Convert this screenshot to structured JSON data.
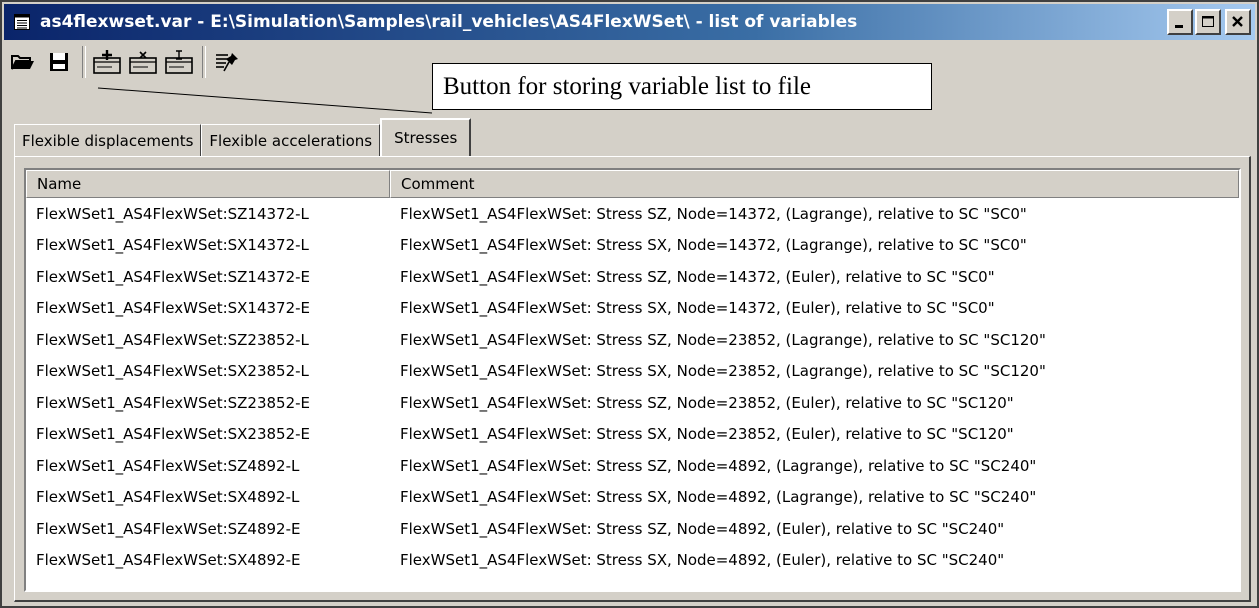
{
  "window": {
    "title": "as4flexwset.var - E:\\Simulation\\Samples\\rail_vehicles\\AS4FlexWSet\\ - list of variables"
  },
  "callout": {
    "text": "Button for storing variable list to file"
  },
  "tabs": [
    {
      "label": "Flexible displacements",
      "active": false
    },
    {
      "label": "Flexible accelerations",
      "active": false
    },
    {
      "label": "Stresses",
      "active": true
    }
  ],
  "list": {
    "columns": [
      "Name",
      "Comment"
    ],
    "rows": [
      {
        "name": "FlexWSet1_AS4FlexWSet:SZ14372-L",
        "comment": "FlexWSet1_AS4FlexWSet: Stress SZ, Node=14372, (Lagrange), relative to SC \"SC0\""
      },
      {
        "name": "FlexWSet1_AS4FlexWSet:SX14372-L",
        "comment": "FlexWSet1_AS4FlexWSet: Stress SX, Node=14372, (Lagrange), relative to SC \"SC0\""
      },
      {
        "name": "FlexWSet1_AS4FlexWSet:SZ14372-E",
        "comment": "FlexWSet1_AS4FlexWSet: Stress SZ, Node=14372, (Euler), relative to SC \"SC0\""
      },
      {
        "name": "FlexWSet1_AS4FlexWSet:SX14372-E",
        "comment": "FlexWSet1_AS4FlexWSet: Stress SX, Node=14372, (Euler), relative to SC \"SC0\""
      },
      {
        "name": "FlexWSet1_AS4FlexWSet:SZ23852-L",
        "comment": "FlexWSet1_AS4FlexWSet: Stress SZ, Node=23852, (Lagrange), relative to SC \"SC120\""
      },
      {
        "name": "FlexWSet1_AS4FlexWSet:SX23852-L",
        "comment": "FlexWSet1_AS4FlexWSet: Stress SX, Node=23852, (Lagrange), relative to SC \"SC120\""
      },
      {
        "name": "FlexWSet1_AS4FlexWSet:SZ23852-E",
        "comment": "FlexWSet1_AS4FlexWSet: Stress SZ, Node=23852, (Euler), relative to SC \"SC120\""
      },
      {
        "name": "FlexWSet1_AS4FlexWSet:SX23852-E",
        "comment": "FlexWSet1_AS4FlexWSet: Stress SX, Node=23852, (Euler), relative to SC \"SC120\""
      },
      {
        "name": "FlexWSet1_AS4FlexWSet:SZ4892-L",
        "comment": "FlexWSet1_AS4FlexWSet: Stress SZ, Node=4892, (Lagrange), relative to SC \"SC240\""
      },
      {
        "name": "FlexWSet1_AS4FlexWSet:SX4892-L",
        "comment": "FlexWSet1_AS4FlexWSet: Stress SX, Node=4892, (Lagrange), relative to SC \"SC240\""
      },
      {
        "name": "FlexWSet1_AS4FlexWSet:SZ4892-E",
        "comment": "FlexWSet1_AS4FlexWSet: Stress SZ, Node=4892, (Euler), relative to SC \"SC240\""
      },
      {
        "name": "FlexWSet1_AS4FlexWSet:SX4892-E",
        "comment": "FlexWSet1_AS4FlexWSet: Stress SX, Node=4892, (Euler), relative to SC \"SC240\""
      }
    ]
  },
  "icons": {
    "title": "document-list-icon",
    "toolbar": [
      "open-folder-icon",
      "save-disk-icon",
      "add-variable-icon",
      "remove-variable-icon",
      "edit-variable-icon",
      "pin-list-icon"
    ]
  },
  "colors": {
    "titlebar_start": "#0a246a",
    "titlebar_end": "#a6caf0",
    "face": "#d4d0c8"
  }
}
